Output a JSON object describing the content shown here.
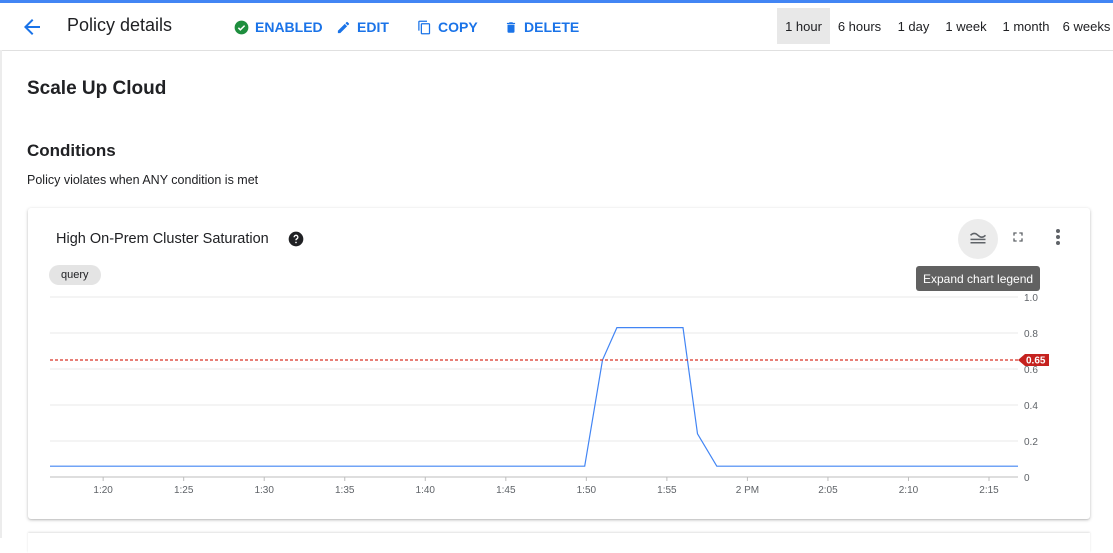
{
  "toolbar": {
    "title": "Policy details",
    "enabled_label": "ENABLED",
    "edit_label": "EDIT",
    "copy_label": "COPY",
    "delete_label": "DELETE",
    "time_ranges": [
      "1 hour",
      "6 hours",
      "1 day",
      "1 week",
      "1 month",
      "6 weeks"
    ],
    "selected_range": "1 hour"
  },
  "policy": {
    "name": "Scale Up Cloud"
  },
  "conditions": {
    "heading": "Conditions",
    "subtitle": "Policy violates when ANY condition is met"
  },
  "chart_card": {
    "title": "High On-Prem Cluster Saturation",
    "chip": "query",
    "tooltip": "Expand chart legend",
    "threshold_label": "0.65"
  },
  "colors": {
    "accent": "#1a73e8",
    "enabled_green": "#1e8e3e",
    "series_line": "#4285f4",
    "threshold": "#d93025"
  },
  "chart_data": {
    "type": "line",
    "x_tick_labels": [
      "1:20",
      "1:25",
      "1:30",
      "1:35",
      "1:40",
      "1:45",
      "1:50",
      "1:55",
      "2 PM",
      "2:05",
      "2:10",
      "2:15"
    ],
    "y_tick_labels": [
      "0",
      "0.2",
      "0.4",
      "0.6",
      "0.8",
      "1.0"
    ],
    "ylim": [
      0,
      1.0
    ],
    "xlim_minutes": [
      -43.3,
      16.8
    ],
    "grid": true,
    "threshold": 0.65,
    "series": [
      {
        "x_minutes": [
          -43.3,
          -10.1,
          -9.0,
          -8.1,
          -7.0,
          -6.0,
          -5.0,
          -4.0,
          -3.1,
          -1.9,
          16.8
        ],
        "values": [
          0.06,
          0.06,
          0.65,
          0.83,
          0.83,
          0.83,
          0.83,
          0.83,
          0.24,
          0.06,
          0.06
        ]
      }
    ]
  }
}
